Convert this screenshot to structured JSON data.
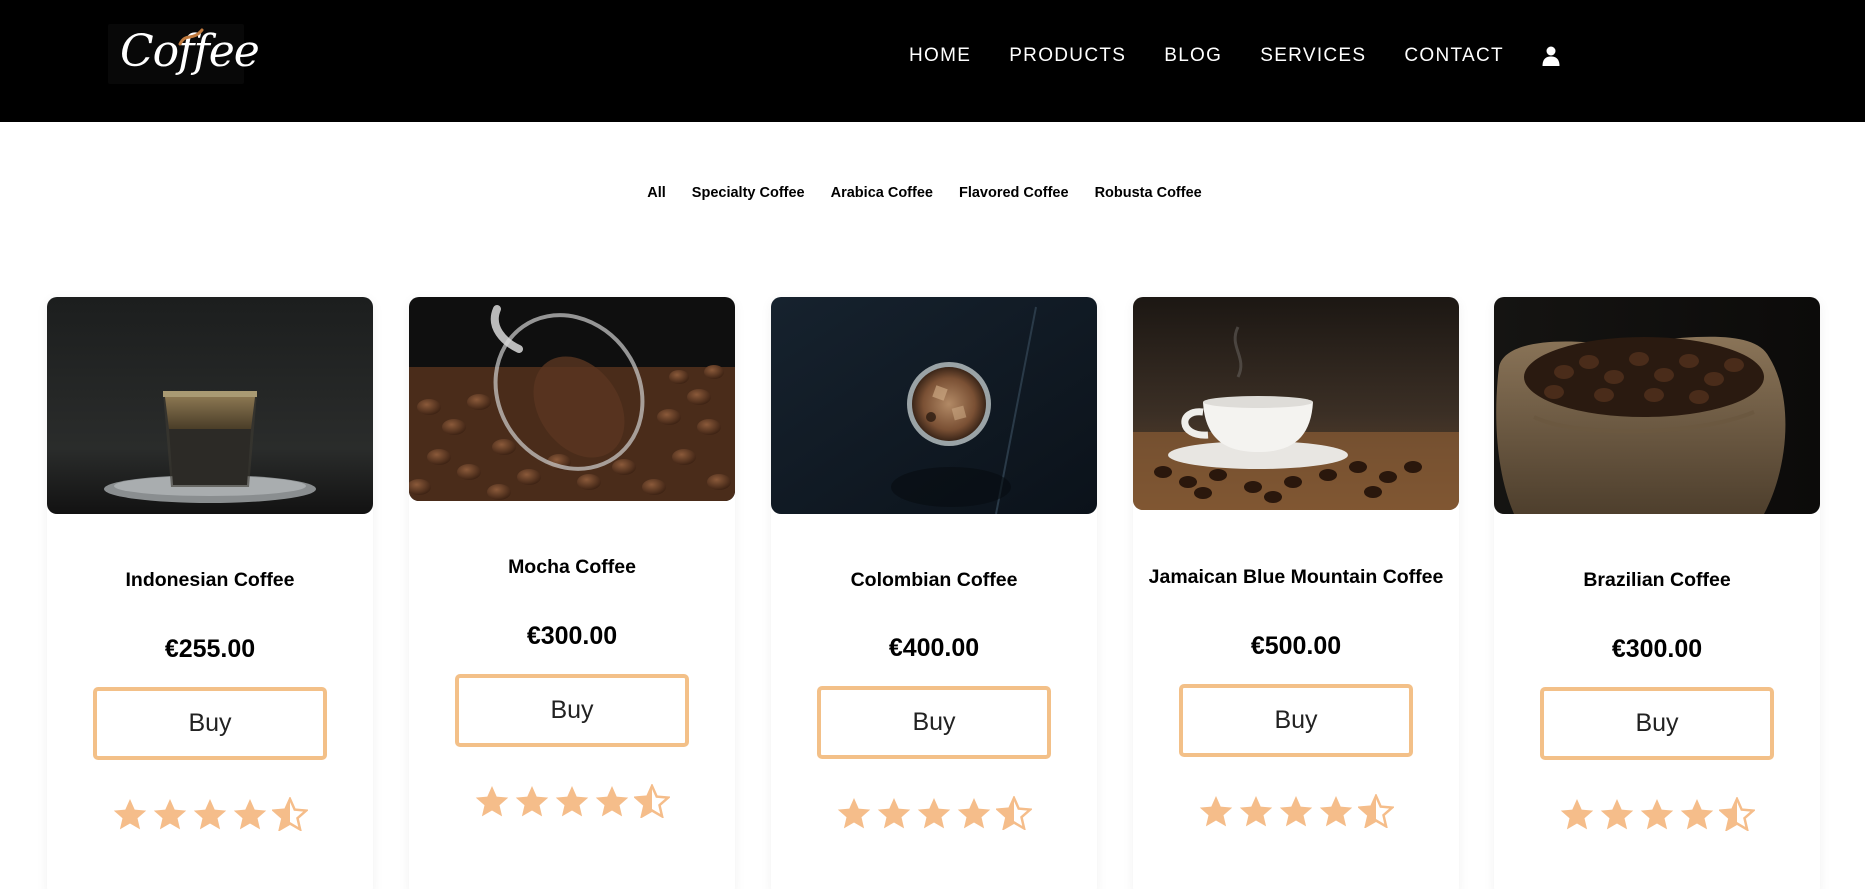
{
  "header": {
    "logo_text": "Coffee",
    "nav": [
      "HOME",
      "PRODUCTS",
      "BLOG",
      "SERVICES",
      "CONTACT"
    ],
    "user_icon": "user-icon"
  },
  "filters": [
    "All",
    "Specialty Coffee",
    "Arabica Coffee",
    "Flavored Coffee",
    "Robusta Coffee"
  ],
  "products": [
    {
      "name": "Indonesian Coffee",
      "price": "€255.00",
      "buy_label": "Buy",
      "rating": 4.5,
      "image": "espresso-glass-on-saucer"
    },
    {
      "name": "Mocha Coffee",
      "price": "€300.00",
      "buy_label": "Buy",
      "rating": 4.5,
      "image": "glass-cup-spilling-beans"
    },
    {
      "name": "Colombian Coffee",
      "price": "€400.00",
      "buy_label": "Buy",
      "rating": 4.5,
      "image": "iced-coffee-top-view"
    },
    {
      "name": "Jamaican Blue Mountain Coffee",
      "price": "€500.00",
      "buy_label": "Buy",
      "rating": 4.5,
      "image": "white-cup-with-beans"
    },
    {
      "name": "Brazilian Coffee",
      "price": "€300.00",
      "buy_label": "Buy",
      "rating": 4.5,
      "image": "burlap-sack-of-beans"
    }
  ],
  "colors": {
    "header_bg": "#000000",
    "accent": "#f3c088",
    "star": "#f5bd8a"
  }
}
